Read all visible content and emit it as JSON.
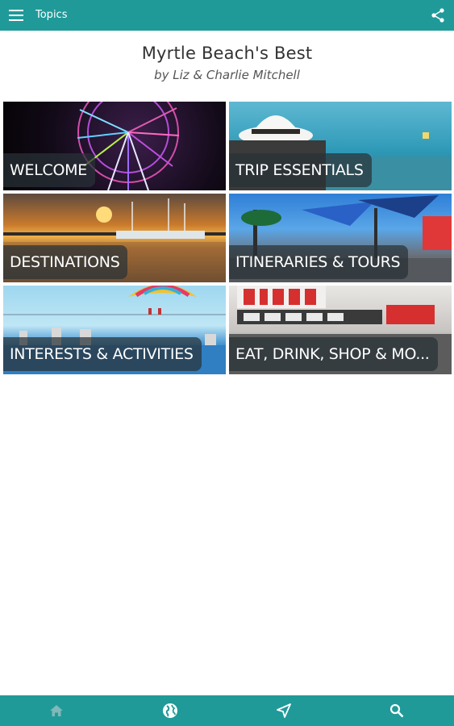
{
  "app_bar": {
    "title": "Topics",
    "menu_icon": "menu-icon",
    "share_icon": "share-icon",
    "background": "#1f9a99"
  },
  "book": {
    "title": "Myrtle Beach's Best",
    "author": "by Liz & Charlie Mitchell"
  },
  "tiles": [
    {
      "label": "WELCOME"
    },
    {
      "label": "TRIP ESSENTIALS"
    },
    {
      "label": "DESTINATIONS"
    },
    {
      "label": "ITINERARIES & TOURS"
    },
    {
      "label": "INTERESTS & ACTIVITIES"
    },
    {
      "label": "EAT, DRINK, SHOP & MO..."
    }
  ],
  "bottom_nav": {
    "items": [
      {
        "icon": "home-icon",
        "active": false
      },
      {
        "icon": "globe-icon",
        "active": true
      },
      {
        "icon": "navigation-icon",
        "active": true
      },
      {
        "icon": "search-icon",
        "active": true
      }
    ]
  }
}
